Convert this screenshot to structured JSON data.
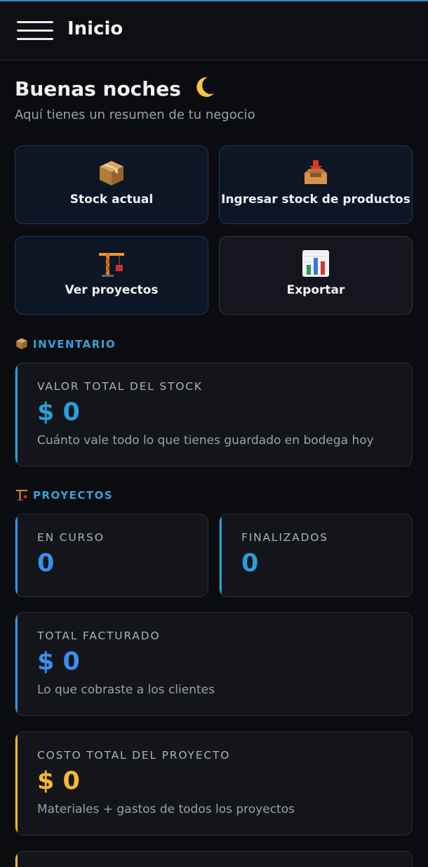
{
  "appbar": {
    "title": "Inicio"
  },
  "header": {
    "greeting": "Buenas noches",
    "subtitle": "Aquí tienes un resumen de tu negocio"
  },
  "quick_actions": [
    {
      "label": "Stock actual",
      "icon": "package-icon"
    },
    {
      "label": "Ingresar stock de productos",
      "icon": "inbox-tray-icon"
    },
    {
      "label": "Ver proyectos",
      "icon": "construction-crane-icon"
    },
    {
      "label": "Exportar",
      "icon": "bar-chart-icon"
    }
  ],
  "inventario": {
    "title": "INVENTARIO",
    "icon": "package-icon",
    "stock_card": {
      "label": "VALOR TOTAL DEL STOCK",
      "value": "$ 0",
      "description": "Cuánto vale todo lo que tienes guardado en bodega hoy"
    }
  },
  "proyectos": {
    "title": "PROYECTOS",
    "icon": "construction-crane-icon",
    "en_curso": {
      "label": "EN CURSO",
      "value": "0"
    },
    "finalizados": {
      "label": "FINALIZADOS",
      "value": "0"
    },
    "facturado": {
      "label": "TOTAL FACTURADO",
      "value": "$ 0",
      "description": "Lo que cobraste a los clientes"
    },
    "costo": {
      "label": "COSTO TOTAL DEL PROYECTO",
      "value": "$ 0",
      "description": "Materiales + gastos de todos los proyectos"
    }
  },
  "colors": {
    "accent_cyan": "#2a9fd8",
    "accent_blue": "#3b8ef0",
    "accent_yellow": "#f5b82e",
    "background": "#0b0c10",
    "card": "#13151b"
  }
}
